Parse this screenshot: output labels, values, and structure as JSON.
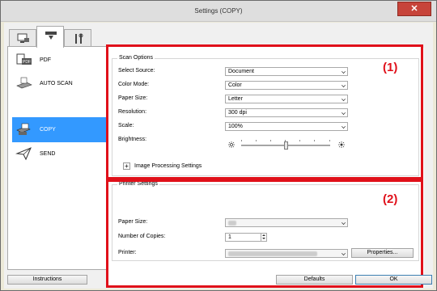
{
  "window": {
    "title": "Settings (COPY)",
    "close_glyph": "✕"
  },
  "tabs": [
    {
      "name": "scan-from-computer-tab",
      "icon": "computer-scan-icon"
    },
    {
      "name": "scan-from-panel-tab",
      "icon": "scanner-panel-icon"
    },
    {
      "name": "general-settings-tab",
      "icon": "tools-icon"
    }
  ],
  "sidebar": {
    "items": [
      {
        "label": "PDF",
        "icon": "pdf-icon"
      },
      {
        "label": "AUTO SCAN",
        "icon": "auto-scan-icon"
      },
      {
        "label": "COPY",
        "icon": "copy-icon",
        "selected": true
      },
      {
        "label": "SEND",
        "icon": "send-icon"
      }
    ]
  },
  "scan_options": {
    "title": "Scan Options",
    "select_source": {
      "label": "Select Source:",
      "value": "Document"
    },
    "color_mode": {
      "label": "Color Mode:",
      "value": "Color"
    },
    "paper_size": {
      "label": "Paper Size:",
      "value": "Letter"
    },
    "resolution": {
      "label": "Resolution:",
      "value": "300 dpi"
    },
    "scale": {
      "label": "Scale:",
      "value": "100%"
    },
    "brightness": {
      "label": "Brightness:",
      "level": 0.5
    },
    "image_processing": {
      "toggle": "+",
      "label": "Image Processing Settings"
    }
  },
  "printer_settings": {
    "title": "Printer Settings",
    "paper_size": {
      "label": "Paper Size:"
    },
    "copies": {
      "label": "Number of Copies:",
      "value": "1"
    },
    "printer": {
      "label": "Printer:"
    },
    "properties_button": "Properties..."
  },
  "callouts": {
    "one": "(1)",
    "two": "(2)"
  },
  "footer": {
    "instructions": "Instructions",
    "defaults": "Defaults",
    "ok": "OK"
  },
  "colors": {
    "highlight_red": "#e0101a",
    "selection_blue": "#3399ff"
  }
}
